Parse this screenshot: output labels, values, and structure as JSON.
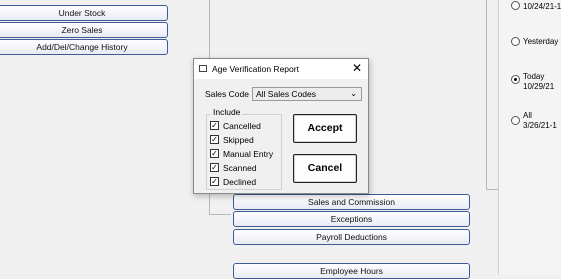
{
  "left_menu": {
    "items": [
      "Under Stock",
      "Zero Sales",
      "Add/Del/Change History"
    ]
  },
  "report_buttons": [
    "Sales and Commission",
    "Exceptions",
    "Payroll Deductions",
    "Employee Hours"
  ],
  "date_options": [
    {
      "label": "10/24/21-1",
      "selected": false
    },
    {
      "label": "Yesterday",
      "selected": false
    },
    {
      "label": "Today\n10/29/21",
      "selected": true
    },
    {
      "label": "All\n3/26/21-1",
      "selected": false
    }
  ],
  "dialog": {
    "title": "Age Verification Report",
    "close_glyph": "✕",
    "sales_code_label": "Sales Code",
    "sales_code_value": "All Sales Codes",
    "include_label": "Include",
    "checkboxes": [
      {
        "label": "Cancelled",
        "checked": true
      },
      {
        "label": "Skipped",
        "checked": true
      },
      {
        "label": "Manual Entry",
        "checked": true
      },
      {
        "label": "Scanned",
        "checked": true
      },
      {
        "label": "Declined",
        "checked": true
      }
    ],
    "accept_label": "Accept",
    "cancel_label": "Cancel"
  }
}
